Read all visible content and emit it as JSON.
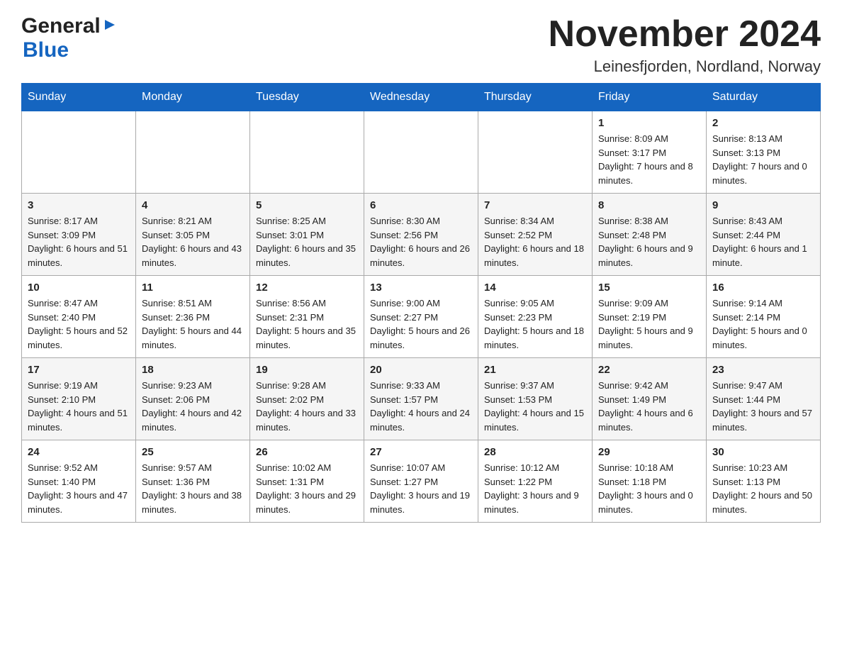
{
  "header": {
    "logo_general": "General",
    "logo_blue": "Blue",
    "month_title": "November 2024",
    "location": "Leinesfjorden, Nordland, Norway"
  },
  "weekdays": [
    "Sunday",
    "Monday",
    "Tuesday",
    "Wednesday",
    "Thursday",
    "Friday",
    "Saturday"
  ],
  "rows": [
    [
      {
        "day": "",
        "info": ""
      },
      {
        "day": "",
        "info": ""
      },
      {
        "day": "",
        "info": ""
      },
      {
        "day": "",
        "info": ""
      },
      {
        "day": "",
        "info": ""
      },
      {
        "day": "1",
        "info": "Sunrise: 8:09 AM\nSunset: 3:17 PM\nDaylight: 7 hours and 8 minutes."
      },
      {
        "day": "2",
        "info": "Sunrise: 8:13 AM\nSunset: 3:13 PM\nDaylight: 7 hours and 0 minutes."
      }
    ],
    [
      {
        "day": "3",
        "info": "Sunrise: 8:17 AM\nSunset: 3:09 PM\nDaylight: 6 hours and 51 minutes."
      },
      {
        "day": "4",
        "info": "Sunrise: 8:21 AM\nSunset: 3:05 PM\nDaylight: 6 hours and 43 minutes."
      },
      {
        "day": "5",
        "info": "Sunrise: 8:25 AM\nSunset: 3:01 PM\nDaylight: 6 hours and 35 minutes."
      },
      {
        "day": "6",
        "info": "Sunrise: 8:30 AM\nSunset: 2:56 PM\nDaylight: 6 hours and 26 minutes."
      },
      {
        "day": "7",
        "info": "Sunrise: 8:34 AM\nSunset: 2:52 PM\nDaylight: 6 hours and 18 minutes."
      },
      {
        "day": "8",
        "info": "Sunrise: 8:38 AM\nSunset: 2:48 PM\nDaylight: 6 hours and 9 minutes."
      },
      {
        "day": "9",
        "info": "Sunrise: 8:43 AM\nSunset: 2:44 PM\nDaylight: 6 hours and 1 minute."
      }
    ],
    [
      {
        "day": "10",
        "info": "Sunrise: 8:47 AM\nSunset: 2:40 PM\nDaylight: 5 hours and 52 minutes."
      },
      {
        "day": "11",
        "info": "Sunrise: 8:51 AM\nSunset: 2:36 PM\nDaylight: 5 hours and 44 minutes."
      },
      {
        "day": "12",
        "info": "Sunrise: 8:56 AM\nSunset: 2:31 PM\nDaylight: 5 hours and 35 minutes."
      },
      {
        "day": "13",
        "info": "Sunrise: 9:00 AM\nSunset: 2:27 PM\nDaylight: 5 hours and 26 minutes."
      },
      {
        "day": "14",
        "info": "Sunrise: 9:05 AM\nSunset: 2:23 PM\nDaylight: 5 hours and 18 minutes."
      },
      {
        "day": "15",
        "info": "Sunrise: 9:09 AM\nSunset: 2:19 PM\nDaylight: 5 hours and 9 minutes."
      },
      {
        "day": "16",
        "info": "Sunrise: 9:14 AM\nSunset: 2:14 PM\nDaylight: 5 hours and 0 minutes."
      }
    ],
    [
      {
        "day": "17",
        "info": "Sunrise: 9:19 AM\nSunset: 2:10 PM\nDaylight: 4 hours and 51 minutes."
      },
      {
        "day": "18",
        "info": "Sunrise: 9:23 AM\nSunset: 2:06 PM\nDaylight: 4 hours and 42 minutes."
      },
      {
        "day": "19",
        "info": "Sunrise: 9:28 AM\nSunset: 2:02 PM\nDaylight: 4 hours and 33 minutes."
      },
      {
        "day": "20",
        "info": "Sunrise: 9:33 AM\nSunset: 1:57 PM\nDaylight: 4 hours and 24 minutes."
      },
      {
        "day": "21",
        "info": "Sunrise: 9:37 AM\nSunset: 1:53 PM\nDaylight: 4 hours and 15 minutes."
      },
      {
        "day": "22",
        "info": "Sunrise: 9:42 AM\nSunset: 1:49 PM\nDaylight: 4 hours and 6 minutes."
      },
      {
        "day": "23",
        "info": "Sunrise: 9:47 AM\nSunset: 1:44 PM\nDaylight: 3 hours and 57 minutes."
      }
    ],
    [
      {
        "day": "24",
        "info": "Sunrise: 9:52 AM\nSunset: 1:40 PM\nDaylight: 3 hours and 47 minutes."
      },
      {
        "day": "25",
        "info": "Sunrise: 9:57 AM\nSunset: 1:36 PM\nDaylight: 3 hours and 38 minutes."
      },
      {
        "day": "26",
        "info": "Sunrise: 10:02 AM\nSunset: 1:31 PM\nDaylight: 3 hours and 29 minutes."
      },
      {
        "day": "27",
        "info": "Sunrise: 10:07 AM\nSunset: 1:27 PM\nDaylight: 3 hours and 19 minutes."
      },
      {
        "day": "28",
        "info": "Sunrise: 10:12 AM\nSunset: 1:22 PM\nDaylight: 3 hours and 9 minutes."
      },
      {
        "day": "29",
        "info": "Sunrise: 10:18 AM\nSunset: 1:18 PM\nDaylight: 3 hours and 0 minutes."
      },
      {
        "day": "30",
        "info": "Sunrise: 10:23 AM\nSunset: 1:13 PM\nDaylight: 2 hours and 50 minutes."
      }
    ]
  ]
}
